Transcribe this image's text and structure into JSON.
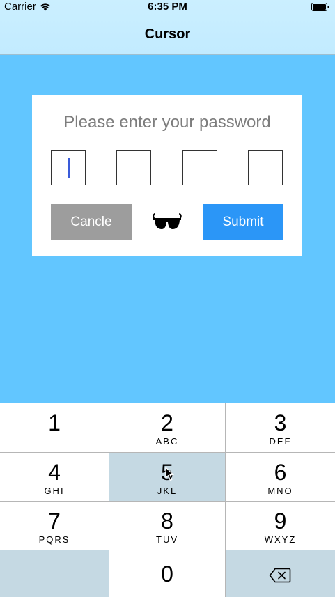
{
  "status_bar": {
    "carrier": "Carrier",
    "time": "6:35 PM",
    "icons": [
      "wifi-icon",
      "battery-icon"
    ]
  },
  "nav": {
    "title": "Cursor"
  },
  "card": {
    "prompt": "Please enter your password",
    "pin_boxes": [
      "",
      "",
      "",
      ""
    ],
    "active_box": 1,
    "cancel_label": "Cancle",
    "submit_label": "Submit",
    "toggle_icon": "glasses-icon"
  },
  "keypad": {
    "keys": [
      {
        "digit": "1",
        "letters": ""
      },
      {
        "digit": "2",
        "letters": "ABC"
      },
      {
        "digit": "3",
        "letters": "DEF"
      },
      {
        "digit": "4",
        "letters": "GHI"
      },
      {
        "digit": "5",
        "letters": "JKL"
      },
      {
        "digit": "6",
        "letters": "MNO"
      },
      {
        "digit": "7",
        "letters": "PQRS"
      },
      {
        "digit": "8",
        "letters": "TUV"
      },
      {
        "digit": "9",
        "letters": "WXYZ"
      },
      {
        "digit": "0",
        "letters": ""
      }
    ],
    "pressed_key": "5",
    "delete_icon": "delete-backspace-icon"
  },
  "colors": {
    "background": "#62c6ff",
    "nav_bar": "#c2ebff",
    "cancel_button": "#9d9d9d",
    "submit_button": "#2b96f7",
    "cursor": "#3a5bd9",
    "key_pressed": "#c5d9e3"
  }
}
